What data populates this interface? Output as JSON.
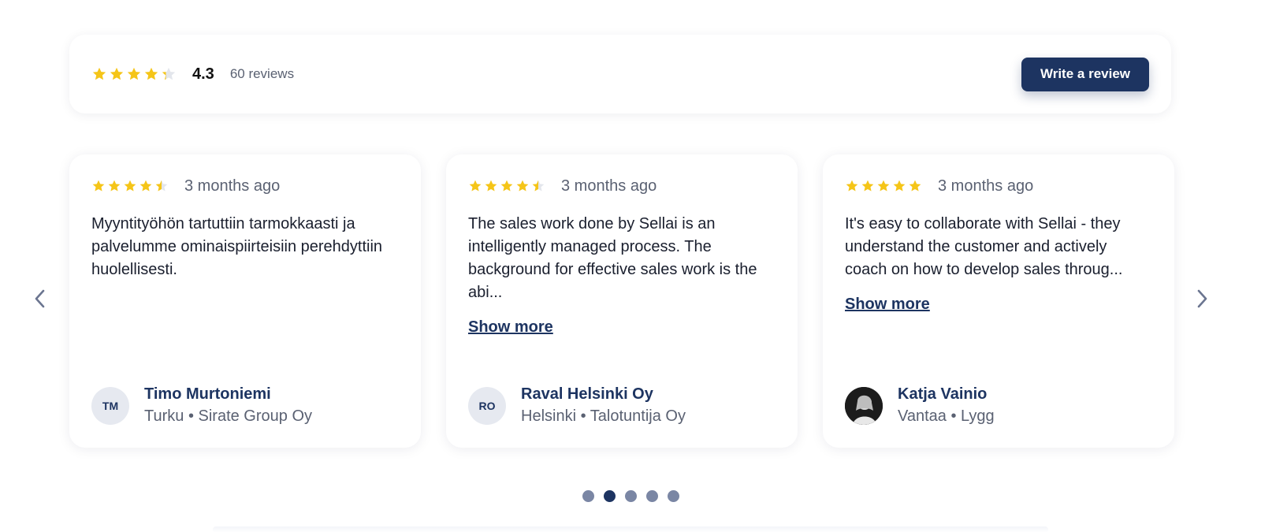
{
  "summary": {
    "rating_value": 4.3,
    "score": "4.3",
    "count": "60 reviews",
    "write_review_label": "Write a review"
  },
  "colors": {
    "star": "#F5C518",
    "star_empty": "#E3E6EC",
    "primary": "#1D3461",
    "muted_text": "#5A6172"
  },
  "icons": {
    "prev": "chevron-left-icon",
    "next": "chevron-right-icon",
    "star": "star-icon"
  },
  "reviews": [
    {
      "rating": 4.5,
      "date": "3 months ago",
      "text": "Myyntityöhön tartuttiin tarmokkaasti ja palvelumme ominaispiirteisiin perehdyttiin huolellisesti.",
      "show_more": "",
      "author_name": "Timo Murtoniemi",
      "author_meta": "Turku • Sirate Group Oy",
      "avatar_initials": "TM"
    },
    {
      "rating": 4.5,
      "date": "3 months ago",
      "text": "The sales work done by Sellai is an intelligently managed process. The background for effective sales work is the abi...",
      "show_more": "Show more",
      "author_name": "Raval Helsinki Oy",
      "author_meta": "Helsinki • Talotuntija Oy",
      "avatar_initials": "RO"
    },
    {
      "rating": 5,
      "date": "3 months ago",
      "text": "It's easy to collaborate with Sellai - they understand the customer and actively coach on how to develop sales throug...",
      "show_more": "Show more",
      "author_name": "Katja Vainio",
      "author_meta": "Vantaa • Lygg",
      "avatar_initials": ""
    }
  ],
  "pagination": {
    "total": 5,
    "active_index": 1
  }
}
